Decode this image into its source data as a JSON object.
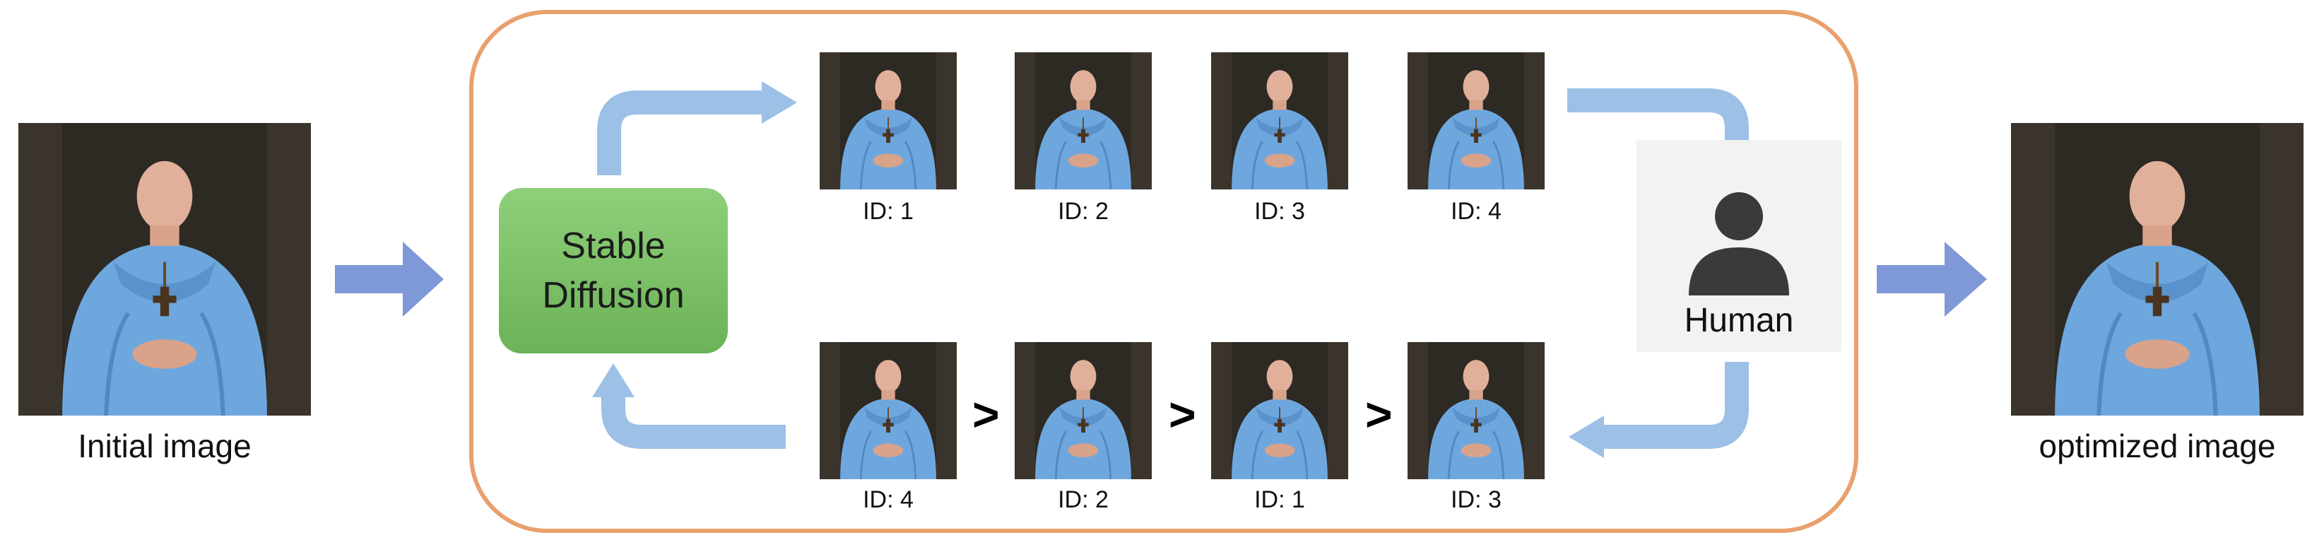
{
  "captions": {
    "initial": "Initial image",
    "optimized": "optimized image"
  },
  "model": {
    "label_line1": "Stable",
    "label_line2": "Diffusion"
  },
  "human": {
    "label": "Human"
  },
  "generated_row": {
    "ids": [
      "ID: 1",
      "ID: 2",
      "ID: 3",
      "ID: 4"
    ]
  },
  "ranked_row": {
    "ids": [
      "ID: 4",
      "ID: 2",
      "ID: 1",
      "ID: 3"
    ],
    "separator": ">"
  },
  "colors": {
    "frame": "#e9a06d",
    "arrow_light": "#9cc0e6",
    "arrow_dark": "#7f98d8",
    "model_box": "#7dc266",
    "robe": "#6ea7de"
  },
  "icons": [
    "person-icon"
  ]
}
